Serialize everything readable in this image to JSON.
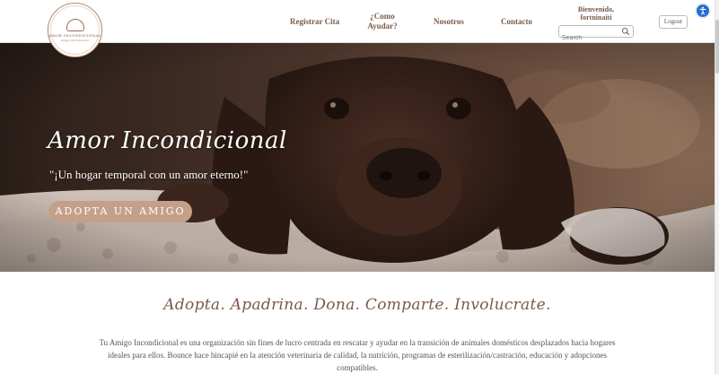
{
  "logo": {
    "title": "AMOR INCONDICIONAL",
    "subtitle": "Amigo Incondicional"
  },
  "nav": {
    "items": [
      {
        "label": "Registrar Cita"
      },
      {
        "label": "¿Como Ayudar?"
      },
      {
        "label": "Nosotros"
      },
      {
        "label": "Contacto"
      }
    ],
    "welcome_line1": "Bienvenido,",
    "welcome_line2": "fortninaiti",
    "search_placeholder": "Search",
    "logout_label": "Logout"
  },
  "hero": {
    "title": "Amor Incondicional",
    "subtitle": "\"¡Un hogar temporal con un amor eterno!\"",
    "cta_label": "ADOPTA UN AMIGO"
  },
  "content": {
    "tagline": "Adopta. Apadrina. Dona. Comparte. Involucrate.",
    "description": "Tu Amigo Incondicional es una organización sin fines de lucro centrada en rescatar y ayudar en la transición de animales domésticos desplazados hacia hogares ideales para ellos. Bounce hace hincapié en la atención veterinaria de calidad, la nutrición, programas de esterilización/castración, educación y adopciones compatibles."
  },
  "colors": {
    "brand_brown": "#7a5a48",
    "button_tan": "#c4a08a",
    "accessibility_blue": "#1e6fd0"
  },
  "icons": [
    "search-icon",
    "accessibility-icon",
    "heart-logo-icon"
  ]
}
